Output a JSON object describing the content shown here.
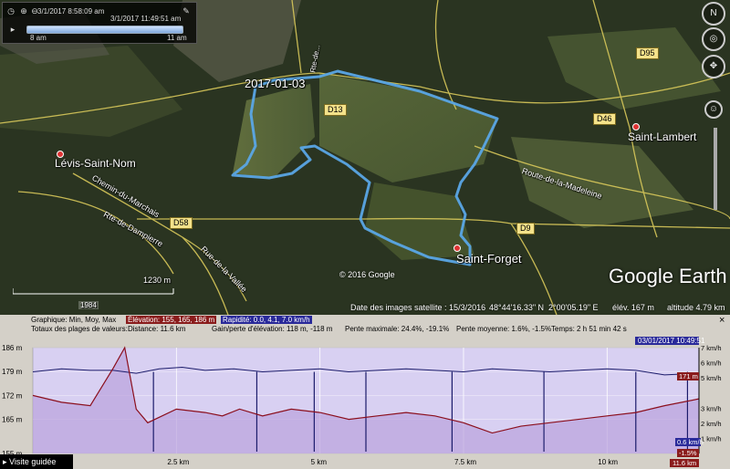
{
  "timeslider": {
    "start_datetime": "3/1/2017  8:58:09 am",
    "end_datetime": "3/1/2017  11:49:51 am",
    "start_label": "8 am",
    "end_label": "11 am"
  },
  "map_labels": {
    "track_date": "2017-01-03",
    "levis": "Lévis-Saint-Nom",
    "saint_lambert": "Saint-Lambert",
    "saint_forget": "Saint-Forget",
    "chemin": "Chemin-du-Marchais",
    "route_dampierre": "Rte-de-Dampierre",
    "rue_vallee": "Rue-de-la-Vallée",
    "route_madeleine": "Route-de-la-Madeleine",
    "rte_de": "Rte-de...",
    "d13": "D13",
    "d58": "D58",
    "d46": "D46",
    "d95": "D95",
    "d9": "D9"
  },
  "map_overlay": {
    "copyright": "© 2016 Google",
    "brand": "Google Earth",
    "scale_label": "1230 m",
    "year_badge": "1984"
  },
  "status_bar": {
    "imagery_date": "Date des images satellite : 15/3/2016",
    "lat": "48°44'16.33\" N",
    "lon": "2°00'05.19\" E",
    "elev": "élév.  167 m",
    "altitude": "altitude   4.79 km"
  },
  "profile": {
    "row1_label": "Graphique:  Min, Moy, Max",
    "elevation_tag": "Élévation:   155, 165, 186 m",
    "speed_tag": "Rapidité:  0.0, 4.1, 7.0 km/h",
    "row2_label": "Totaux des plages de valeurs:",
    "distance": "Distance:   11.6 km",
    "gain": "Gain/perte d'élévation:   118 m, -118 m",
    "pente_max": "Pente maximale:   24.4%, -19.1%",
    "pente_moy": "Pente moyenne:   1.6%, -1.5%",
    "temps": "Temps:   2 h 51 min 42 s",
    "close_icon": "×",
    "datetime_badge": "03/01/2017 10:49:51",
    "elev_badge": "171 m",
    "speed_badge": "0.6 km/h",
    "slope_badge": "-1.5%",
    "dist_badge": "11.6 km",
    "visite": "Visite guidée"
  },
  "chart_data": {
    "type": "line",
    "title": "",
    "xlabel": "",
    "ylabel": "",
    "x_ticks": [
      "2.5 km",
      "5 km",
      "7.5 km",
      "10 km"
    ],
    "y_left_ticks": [
      "186 m",
      "179 m",
      "172 m",
      "165 m",
      "155 m"
    ],
    "y_right_ticks": [
      "7 km/h",
      "6 km/h",
      "5 km/h",
      "3 km/h",
      "2 km/h",
      "1 km/h"
    ],
    "xlim": [
      0,
      11.6
    ],
    "ylim_left": [
      155,
      186
    ],
    "ylim_right": [
      0,
      7
    ],
    "series": [
      {
        "axis": "left",
        "x": [
          0,
          0.5,
          1.0,
          1.4,
          1.6,
          1.8,
          2.0,
          2.5,
          3.0,
          3.3,
          3.6,
          4.0,
          4.5,
          5.0,
          5.5,
          6.0,
          6.5,
          7.0,
          7.5,
          8.0,
          8.5,
          9.0,
          9.5,
          10.0,
          10.5,
          11.0,
          11.6
        ],
        "y": [
          172,
          170,
          169,
          180,
          186,
          168,
          164,
          168,
          167,
          166,
          168,
          166,
          168,
          167,
          165,
          166,
          167,
          166,
          164,
          161,
          163,
          164,
          165,
          166,
          167,
          169,
          171
        ],
        "color": "#8b0f1d"
      },
      {
        "axis": "right",
        "x": [
          0,
          0.5,
          1.0,
          1.4,
          1.8,
          2.2,
          2.6,
          3.0,
          3.5,
          4.0,
          4.5,
          5.0,
          5.5,
          6.0,
          6.5,
          7.0,
          7.5,
          8.0,
          8.5,
          9.0,
          9.5,
          10.0,
          10.5,
          11.0,
          11.6
        ],
        "y": [
          5.4,
          5.6,
          5.5,
          5.5,
          5.3,
          5.6,
          5.7,
          5.5,
          5.6,
          5.4,
          5.5,
          5.6,
          5.4,
          5.5,
          5.6,
          5.5,
          5.4,
          5.6,
          5.5,
          5.4,
          5.5,
          5.6,
          5.5,
          5.2,
          5.3
        ],
        "color": "#1b1b6b"
      }
    ],
    "dips_x": [
      2.1,
      3.9,
      4.9,
      5.8,
      7.3,
      8.9,
      10.5,
      11.4
    ],
    "cursor_x": 11.6,
    "grid": true
  }
}
